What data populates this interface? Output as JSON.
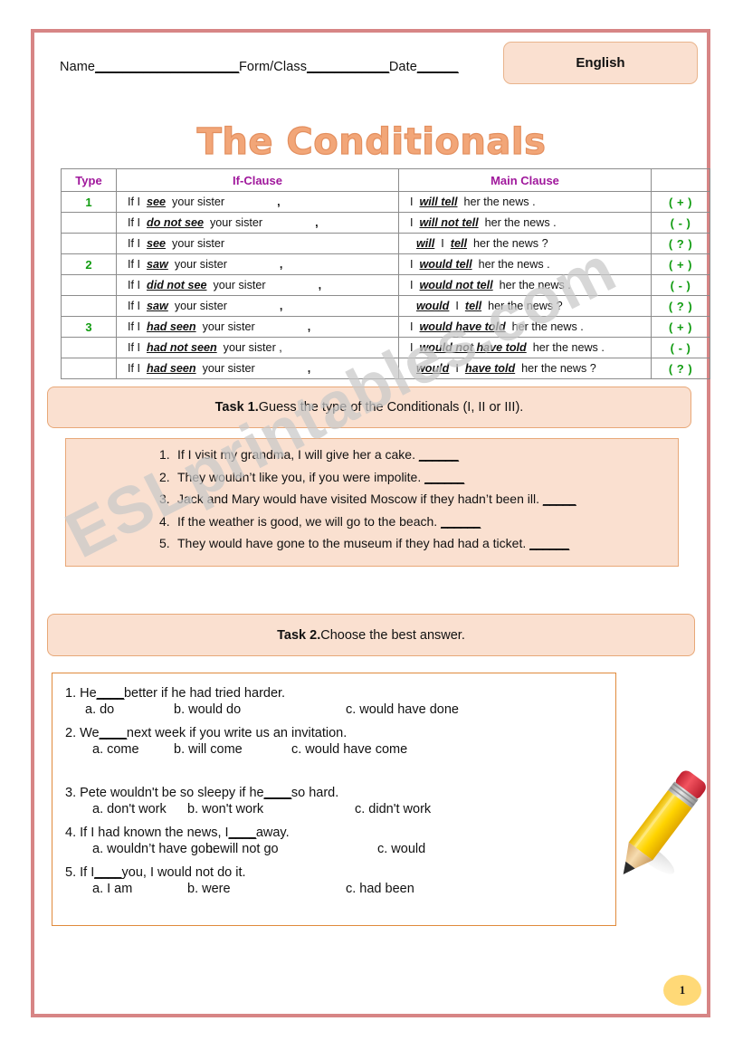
{
  "header": {
    "name_label": "Name",
    "name_blank": "_____________________",
    "form_label": "Form/Class",
    "form_blank": "____________",
    "date_label": "Date",
    "date_blank": "______",
    "subject_badge": "English"
  },
  "title": "The Conditionals",
  "table": {
    "headers": [
      "Type",
      "If-Clause",
      "Main Clause",
      ""
    ],
    "rows": [
      {
        "type": "1",
        "if_pre": "If I",
        "if_verb": "see",
        "if_post": "your sister",
        "if_comma": ",",
        "main_pre": "I",
        "main_verb": "will tell",
        "main_post": "her the news .",
        "sign": "( + )"
      },
      {
        "type": "",
        "if_pre": "If I",
        "if_verb": "do not  see",
        "if_post": "your sister",
        "if_comma": ",",
        "main_pre": "I",
        "main_verb": "will not tell",
        "main_post": "her the news .",
        "sign": "( - )"
      },
      {
        "type": "",
        "if_pre": "If I",
        "if_verb": "see",
        "if_post": "your sister",
        "if_comma": "",
        "main_pre": "",
        "main_verb": "will",
        "main_mid": "I",
        "main_verb2": "tell",
        "main_post": "her the news ?",
        "sign": "( ? )"
      },
      {
        "type": "2",
        "if_pre": "If I",
        "if_verb": "saw",
        "if_post": "your sister",
        "if_comma": ",",
        "main_pre": "I",
        "main_verb": "would tell",
        "main_post": "her the news .",
        "sign": "( + )"
      },
      {
        "type": "",
        "if_pre": "If I",
        "if_verb": "did not  see",
        "if_post": "your sister",
        "if_comma": ",",
        "main_pre": "I",
        "main_verb": "would not tell",
        "main_post": "her the news .",
        "sign": "( - )"
      },
      {
        "type": "",
        "if_pre": "If I",
        "if_verb": "saw",
        "if_post": "your sister",
        "if_comma": ",",
        "main_pre": "",
        "main_verb": "would",
        "main_mid": "I",
        "main_verb2": "tell",
        "main_post": "her the news ?",
        "sign": "( ? )"
      },
      {
        "type": "3",
        "if_pre": "If I",
        "if_verb": "had seen",
        "if_post": "your sister",
        "if_comma": ",",
        "main_pre": "I",
        "main_verb": "would have told",
        "main_post": "her the news .",
        "sign": "( + )"
      },
      {
        "type": "",
        "if_pre": "If I",
        "if_verb": "had not  seen",
        "if_post": "your sister ,",
        "if_comma": "",
        "main_pre": "I",
        "main_verb": "would not have told",
        "main_post": "her the news .",
        "sign": "( - )"
      },
      {
        "type": "",
        "if_pre": "If I",
        "if_verb": "had  seen",
        "if_post": "your sister",
        "if_comma": ",",
        "main_pre": "",
        "main_verb": "would",
        "main_mid": "I",
        "main_verb2": "have told",
        "main_post": "her the news ?",
        "sign": "( ? )"
      }
    ]
  },
  "task1": {
    "label": "Task 1.",
    "instruction": " Guess the type of the Conditionals (I, II or III).",
    "items": [
      {
        "num": "1.",
        "text": "If I visit my grandma, I will give her a cake.",
        "blank": "______"
      },
      {
        "num": "2.",
        "text": "They wouldn’t like you, if you were impolite.",
        "blank": "______"
      },
      {
        "num": "3.",
        "text": "Jack and Mary would have visited Moscow if they hadn’t been ill.",
        "blank": "_____"
      },
      {
        "num": "4.",
        "text": "If the weather is good, we will go to the beach.",
        "blank": "______"
      },
      {
        "num": "5.",
        "text": "They would have gone to the museum if they had had a ticket.",
        "blank": "______"
      }
    ]
  },
  "task2": {
    "label": "Task 2.",
    "instruction": " Choose the best answer.",
    "questions": [
      {
        "stem_pre": "1. He",
        "stem_blank": "____",
        "stem_post": "better if he had tried harder.",
        "options": [
          "a.   do",
          "b. would do",
          "c. would have done"
        ]
      },
      {
        "stem_pre": "2. We",
        "stem_blank": "____",
        "stem_post": "next week if you write us an invitation.",
        "options": [
          "a. come",
          "b. will come",
          "c. would have come"
        ]
      },
      {
        "stem_pre": "3. Pete wouldn't be so sleepy if he",
        "stem_blank": "____",
        "stem_post": "so hard.",
        "options": [
          "a. don't work",
          "b. won't work",
          "c. didn't work"
        ]
      },
      {
        "stem_pre": "4. If  I had known the news, I",
        "stem_blank": "____",
        "stem_post": "away.",
        "options": [
          "a. wouldn’t have gone",
          "b. will not go",
          "c. would"
        ]
      },
      {
        "stem_pre": "5. If I",
        "stem_blank": "____",
        "stem_post": "you, I would not do it.",
        "options": [
          "a. I am",
          "b. were",
          "c. had been"
        ]
      }
    ]
  },
  "watermark": "ESLprintables.com",
  "page_number": "1",
  "colors": {
    "border_rose": "#d78585",
    "peach_fill": "#fae0d0",
    "peach_border": "#e8a878",
    "orange_border": "#e08a3c",
    "title_orange": "#f2a678",
    "header_purple": "#a0189c",
    "green": "#119c11",
    "badge_yellow": "#ffd977"
  }
}
